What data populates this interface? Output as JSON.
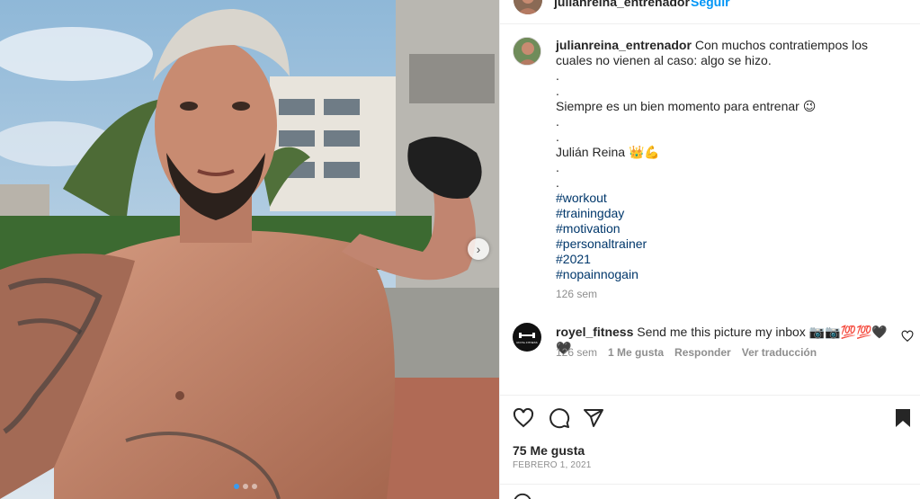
{
  "post": {
    "username": "julianreina_entrenador",
    "follow_label": "Seguir"
  },
  "caption": {
    "username": "julianreina_entrenador",
    "lines": [
      "Con muchos contratiempos los cuales no vienen al caso: algo se hizo.",
      ".",
      ".",
      "Siempre es un bien momento para entrenar 😉",
      ".",
      ".",
      "Julián Reina 👑💪",
      ".",
      "."
    ],
    "hashtags": [
      "#workout",
      "#trainingday",
      "#motivation",
      "#personaltrainer",
      "#2021",
      "#nopainnogain"
    ],
    "time": "126 sem"
  },
  "comment": {
    "username": "royel_fitness",
    "avatar_text": "ROYAL FITNESS",
    "text": "Send me this picture my inbox 📷📷💯💯🖤🖤",
    "time": "126 sem",
    "likes": "1 Me gusta",
    "reply": "Responder",
    "translate": "Ver traducción"
  },
  "footer": {
    "likes": "75 Me gusta",
    "date": "FEBRERO 1, 2021"
  },
  "carousel": {
    "slide_count": 3,
    "active_index": 0
  },
  "colors": {
    "link": "#00376b",
    "follow": "#0095f6",
    "muted": "#8e8e8e"
  }
}
